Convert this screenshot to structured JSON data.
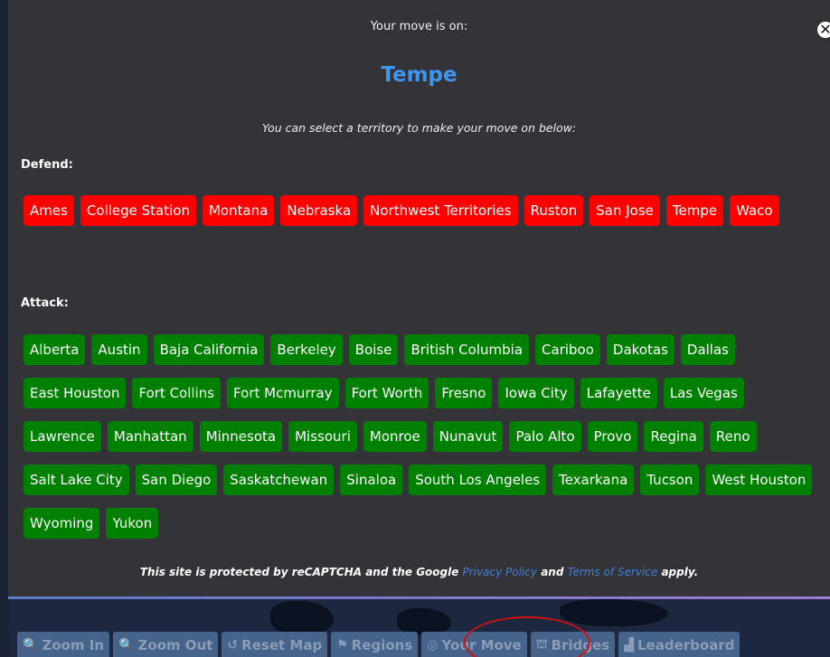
{
  "modal": {
    "move_label": "Your move is on:",
    "move_target": "Tempe",
    "instructions": "You can select a territory to make your move on below:",
    "close_glyph": "✕",
    "defend_title": "Defend:",
    "attack_title": "Attack:",
    "defend": [
      "Ames",
      "College Station",
      "Montana",
      "Nebraska",
      "Northwest Territories",
      "Ruston",
      "San Jose",
      "Tempe",
      "Waco"
    ],
    "attack": [
      "Alberta",
      "Austin",
      "Baja California",
      "Berkeley",
      "Boise",
      "British Columbia",
      "Cariboo",
      "Dakotas",
      "Dallas",
      "East Houston",
      "Fort Collins",
      "Fort Mcmurray",
      "Fort Worth",
      "Fresno",
      "Iowa City",
      "Lafayette",
      "Las Vegas",
      "Lawrence",
      "Manhattan",
      "Minnesota",
      "Missouri",
      "Monroe",
      "Nunavut",
      "Palo Alto",
      "Provo",
      "Regina",
      "Reno",
      "Salt Lake City",
      "San Diego",
      "Saskatchewan",
      "Sinaloa",
      "South Los Angeles",
      "Texarkana",
      "Tucson",
      "West Houston",
      "Wyoming",
      "Yukon"
    ],
    "recaptcha": {
      "prefix": "This site is protected by reCAPTCHA and the Google",
      "privacy": "Privacy Policy",
      "and": "and",
      "terms": "Terms of Service",
      "suffix": "apply."
    }
  },
  "toolbar": [
    {
      "name": "zoom-in-button",
      "icon": "zoom-in-icon",
      "glyph": "🔍",
      "label": "Zoom In"
    },
    {
      "name": "zoom-out-button",
      "icon": "zoom-out-icon",
      "glyph": "🔍",
      "label": "Zoom Out"
    },
    {
      "name": "reset-map-button",
      "icon": "reset-icon",
      "glyph": "↺",
      "label": "Reset Map"
    },
    {
      "name": "regions-button",
      "icon": "flag-icon",
      "glyph": "⚑",
      "label": "Regions"
    },
    {
      "name": "your-move-button",
      "icon": "target-icon",
      "glyph": "◎",
      "label": "Your Move"
    },
    {
      "name": "bridges-button",
      "icon": "bridge-icon",
      "glyph": "⛫",
      "label": "Bridges"
    },
    {
      "name": "leaderboard-button",
      "icon": "leaderboard-icon",
      "glyph": "▟",
      "label": "Leaderboard"
    }
  ],
  "colors": {
    "defend": "#ff0000",
    "attack": "#008000",
    "target": "#3e96f0",
    "modal_bg": "#333338"
  }
}
